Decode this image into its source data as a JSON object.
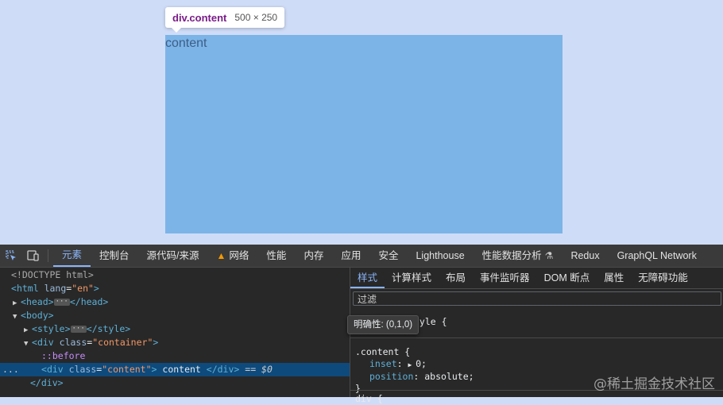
{
  "viewport": {
    "content_text": "content",
    "tooltip": {
      "selector": "div.content",
      "size": "500 × 250"
    }
  },
  "devtools": {
    "tabs": [
      {
        "label": "元素",
        "active": true
      },
      {
        "label": "控制台"
      },
      {
        "label": "源代码/来源"
      },
      {
        "label": "网络",
        "warning": true
      },
      {
        "label": "性能"
      },
      {
        "label": "内存"
      },
      {
        "label": "应用"
      },
      {
        "label": "安全"
      },
      {
        "label": "Lighthouse"
      },
      {
        "label": "性能数据分析",
        "flask": true
      },
      {
        "label": "Redux"
      },
      {
        "label": "GraphQL Network"
      }
    ],
    "elements": {
      "doctype": "<!DOCTYPE html>",
      "html_tag": "html",
      "html_attr": "lang",
      "html_val": "\"en\"",
      "head_tag": "head",
      "body_tag": "body",
      "style_tag": "style",
      "container_tag": "div",
      "container_attr": "class",
      "container_val": "\"container\"",
      "before": "::before",
      "content_tag": "div",
      "content_attr": "class",
      "content_val": "\"content\"",
      "content_text": " content ",
      "selected_marker": "== $0",
      "close_div": "</div>",
      "dots": "..."
    },
    "styles": {
      "tabs": [
        {
          "label": "样式",
          "active": true
        },
        {
          "label": "计算样式"
        },
        {
          "label": "布局"
        },
        {
          "label": "事件监听器"
        },
        {
          "label": "DOM 断点"
        },
        {
          "label": "属性"
        },
        {
          "label": "无障碍功能"
        }
      ],
      "filter_placeholder": "过滤",
      "element_style_fragment": "tyle {",
      "specificity": "明确性: (0,1,0)",
      "rule_selector": ".content {",
      "props": [
        {
          "name": "inset",
          "value": "0;"
        },
        {
          "name": "position",
          "value": "absolute;"
        }
      ],
      "rule_close": "}",
      "next_rule": "div {"
    },
    "watermark": "@稀土掘金技术社区"
  }
}
